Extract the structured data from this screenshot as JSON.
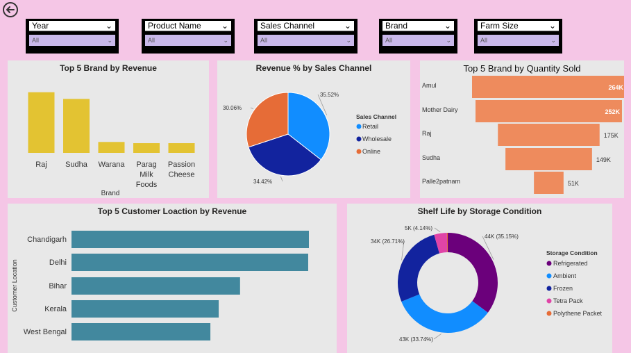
{
  "slicers": [
    {
      "label": "Year",
      "value": "All"
    },
    {
      "label": "Product Name",
      "value": "All"
    },
    {
      "label": "Sales Channel",
      "value": "All"
    },
    {
      "label": "Brand",
      "value": "All"
    },
    {
      "label": "Farm Size",
      "value": "All"
    }
  ],
  "charts": {
    "brand_revenue": {
      "title": "Top 5 Brand by Revenue",
      "xlabel": "Brand",
      "tick_labels": [
        [
          "Raj"
        ],
        [
          "Sudha"
        ],
        [
          "Warana"
        ],
        [
          "Parag",
          "Milk",
          "Foods"
        ],
        [
          "Passion",
          "Cheese"
        ]
      ]
    },
    "sales_channel": {
      "title": "Revenue % by Sales Channel",
      "legend_title": "Sales Channel",
      "labels": [
        "Retail",
        "Wholesale",
        "Online"
      ],
      "value_labels": [
        "35.52%",
        "34.42%",
        "30.06%"
      ]
    },
    "brand_quantity": {
      "title": "Top 5 Brand by Quantity Sold",
      "labels": [
        "Amul",
        "Mother Dairy",
        "Raj",
        "Sudha",
        "Palle2patnam"
      ],
      "value_labels": [
        "264K",
        "252K",
        "175K",
        "149K",
        "51K"
      ]
    },
    "customer_location": {
      "title": "Top 5 Customer Loaction by Revenue",
      "ylabel": "Customer Location",
      "labels": [
        "Chandigarh",
        "Delhi",
        "Bihar",
        "Kerala",
        "West Bengal"
      ]
    },
    "shelf_life": {
      "title": "Shelf Life by Storage Condition",
      "legend_title": "Storage Condition",
      "labels": [
        "Refrigerated",
        "Ambient",
        "Frozen",
        "Tetra Pack",
        "Polythene Packet"
      ],
      "value_labels": [
        "44K (35.15%)",
        "43K (33.74%)",
        "34K (26.71%)",
        "5K (4.14%)",
        ""
      ]
    }
  },
  "colors": {
    "background": "#f5c6e6",
    "panel": "#e8e8e8",
    "brand_bar": "#e3c332",
    "funnel": "#ee8b5d",
    "location_bar": "#42889e",
    "retail": "#118dff",
    "wholesale": "#12239e",
    "online": "#e66c37",
    "refrigerated": "#6b007b",
    "ambient": "#118dff",
    "frozen": "#12239e",
    "tetra_pack": "#e044a7",
    "polythene": "#e66c37"
  },
  "chart_data": [
    {
      "type": "bar",
      "title": "Top 5 Brand by Revenue",
      "xlabel": "Brand",
      "categories": [
        "Raj",
        "Sudha",
        "Warana",
        "Parag Milk Foods",
        "Passion Cheese"
      ],
      "values": [
        100,
        89,
        18,
        16,
        16
      ],
      "ylim": [
        0,
        110
      ],
      "grid": false
    },
    {
      "type": "pie",
      "title": "Revenue % by Sales Channel",
      "categories": [
        "Retail",
        "Wholesale",
        "Online"
      ],
      "values": [
        35.52,
        34.42,
        30.06
      ],
      "legend": "right"
    },
    {
      "type": "bar",
      "title": "Top 5 Brand by Quantity Sold",
      "categories": [
        "Amul",
        "Mother Dairy",
        "Raj",
        "Sudha",
        "Palle2patnam"
      ],
      "values": [
        264,
        252,
        175,
        149,
        51
      ],
      "unit": "K"
    },
    {
      "type": "bar",
      "title": "Top 5 Customer Loaction by Revenue",
      "ylabel": "Customer Location",
      "categories": [
        "Chandigarh",
        "Delhi",
        "Bihar",
        "Kerala",
        "West Bengal"
      ],
      "values": [
        100,
        99.7,
        71,
        62,
        58.5
      ],
      "xlim": [
        0,
        100
      ]
    },
    {
      "type": "pie",
      "title": "Shelf Life by Storage Condition",
      "categories": [
        "Refrigerated",
        "Ambient",
        "Frozen",
        "Tetra Pack",
        "Polythene Packet"
      ],
      "values": [
        35.15,
        33.74,
        26.71,
        4.14,
        0.26
      ],
      "legend": "right"
    }
  ]
}
